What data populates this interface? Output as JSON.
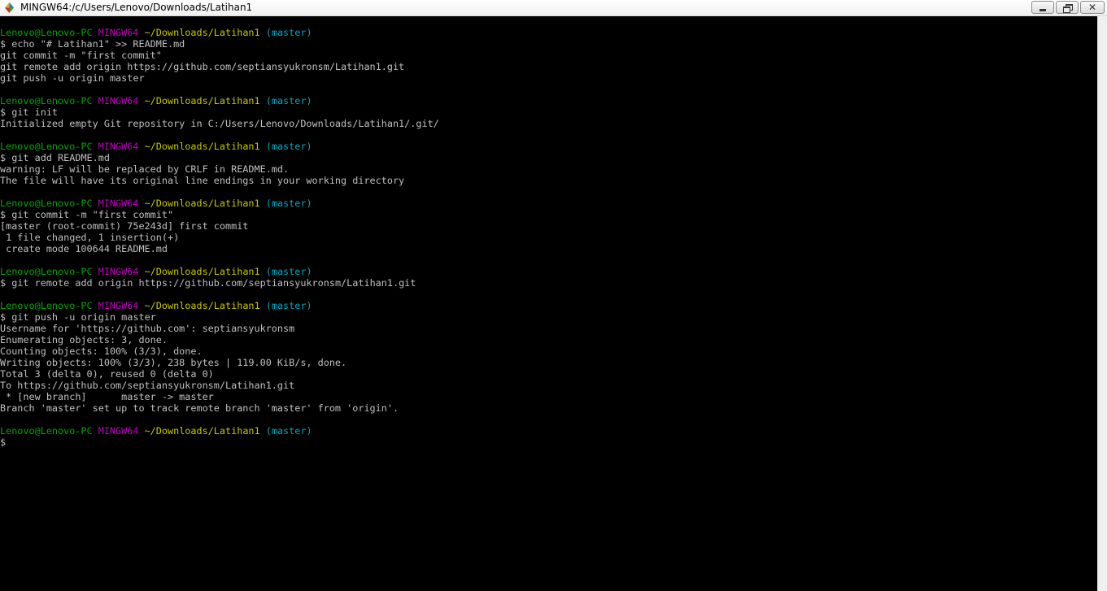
{
  "window": {
    "title": "MINGW64:/c/Users/Lenovo/Downloads/Latihan1",
    "icon": "mingw-app-icon",
    "buttons": {
      "minimize": "minimize-icon",
      "maximize": "restore-icon",
      "close": "close-icon"
    }
  },
  "prompt": {
    "user": "Lenovo@Lenovo-PC",
    "system": "MINGW64",
    "path": "~/Downloads/Latihan1",
    "branch": "(master)",
    "symbol": "$"
  },
  "colors": {
    "user": "#00a800",
    "system": "#c000c0",
    "path": "#c8c800",
    "branch": "#00a8c0",
    "text": "#c0c0c0",
    "background": "#000000"
  },
  "blocks": [
    {
      "command": "echo \"# Latihan1\" >> README.md",
      "output": [
        "git commit -m \"first commit\"",
        "git remote add origin https://github.com/septiansyukronsm/Latihan1.git",
        "git push -u origin master"
      ]
    },
    {
      "command": "git init",
      "output": [
        "Initialized empty Git repository in C:/Users/Lenovo/Downloads/Latihan1/.git/"
      ]
    },
    {
      "command": "git add README.md",
      "output": [
        "warning: LF will be replaced by CRLF in README.md.",
        "The file will have its original line endings in your working directory"
      ]
    },
    {
      "command": "git commit -m \"first commit\"",
      "output": [
        "[master (root-commit) 75e243d] first commit",
        " 1 file changed, 1 insertion(+)",
        " create mode 100644 README.md"
      ]
    },
    {
      "command": "git remote add origin https://github.com/septiansyukronsm/Latihan1.git",
      "output": []
    },
    {
      "command": "git push -u origin master",
      "output": [
        "Username for 'https://github.com': septiansyukronsm",
        "Enumerating objects: 3, done.",
        "Counting objects: 100% (3/3), done.",
        "Writing objects: 100% (3/3), 238 bytes | 119.00 KiB/s, done.",
        "Total 3 (delta 0), reused 0 (delta 0)",
        "To https://github.com/septiansyukronsm/Latihan1.git",
        " * [new branch]      master -> master",
        "Branch 'master' set up to track remote branch 'master' from 'origin'."
      ]
    },
    {
      "command": "",
      "output": []
    }
  ]
}
